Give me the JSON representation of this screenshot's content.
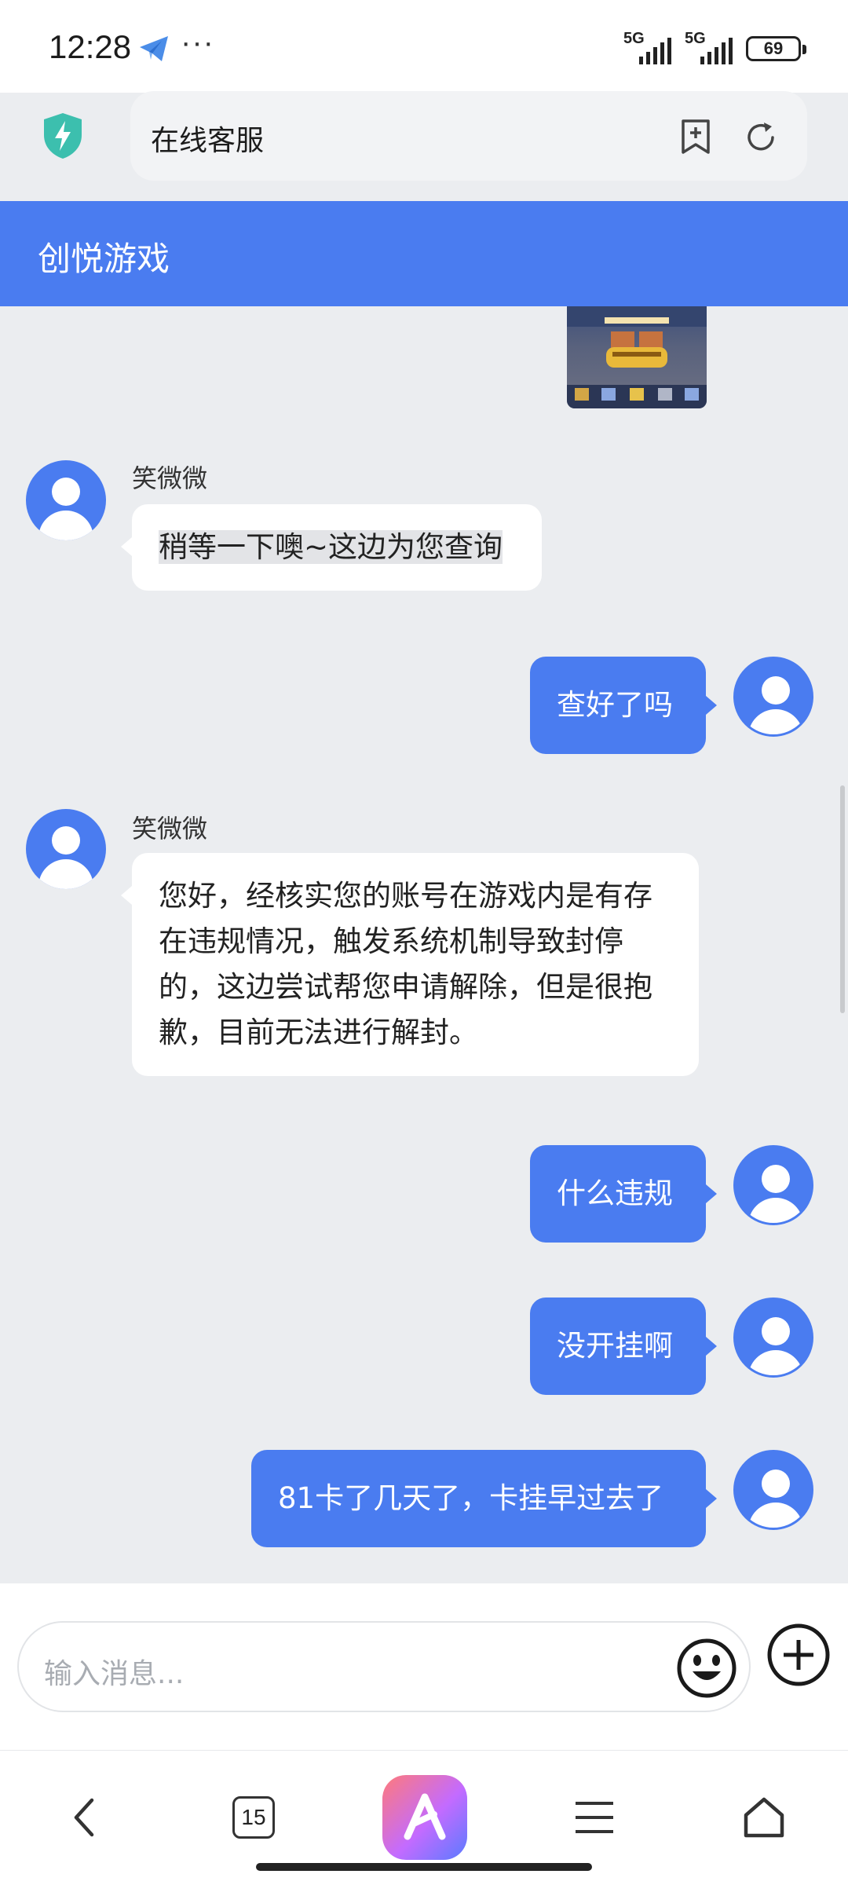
{
  "status_bar": {
    "time": "12:28",
    "dots": "···",
    "network_1": "5G",
    "network_2": "5G",
    "battery": "69"
  },
  "address_bar": {
    "url_text": "在线客服"
  },
  "chat": {
    "title": "创悦游戏",
    "messages": [
      {
        "side": "left",
        "sender": "笑微微",
        "text": "稍等一下噢~这边为您查询"
      },
      {
        "side": "right",
        "text": "查好了吗"
      },
      {
        "side": "left",
        "sender": "笑微微",
        "text": "您好，经核实您的账号在游戏内是有存在违规情况，触发系统机制导致封停的，这边尝试帮您申请解除，但是很抱歉，目前无法进行解封。"
      },
      {
        "side": "right",
        "text": "什么违规"
      },
      {
        "side": "right",
        "text": "没开挂啊"
      },
      {
        "side": "right",
        "text": "81卡了几天了，卡挂早过去了"
      }
    ]
  },
  "input": {
    "placeholder": "输入消息..."
  },
  "bottom_nav": {
    "tab_count": "15"
  },
  "colors": {
    "accent": "#4a7cf0",
    "chat_background": "#ebedf0"
  },
  "icons": [
    "shield-icon",
    "bookmark-add-icon",
    "refresh-icon",
    "emoji-icon",
    "plus-icon",
    "back-icon",
    "tabs-icon",
    "ai-assistant-icon",
    "menu-icon",
    "home-icon"
  ]
}
